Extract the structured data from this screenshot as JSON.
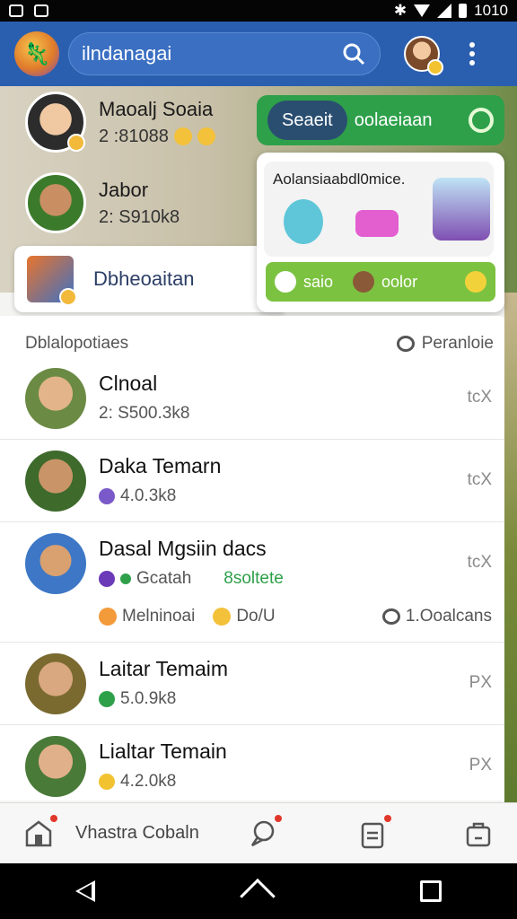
{
  "status_bar": {
    "time": "1010"
  },
  "app_bar": {
    "title": "ilndanagai",
    "logo_icon": "app-logo",
    "search_icon": "search-icon",
    "more_icon": "more-vert-icon"
  },
  "stories": [
    {
      "name": "Maoalj Soaia",
      "sub": "2 :81088"
    },
    {
      "name": "Jabor",
      "sub": "2: S910k8"
    }
  ],
  "highlight": {
    "label": "Dbheoaitan"
  },
  "popup": {
    "tab_selected": "Seaeit",
    "tab_label": "oolaeiaan",
    "card_title": "Aolansiaabdl0mice.",
    "foot_left": "saio",
    "foot_right": "oolor"
  },
  "list": {
    "header_left": "Dblalopotiaes",
    "header_right": "Peranloie",
    "items": [
      {
        "name": "Clnoal",
        "sub": "2: S500.3k8",
        "action": "tcX",
        "avatar_color": "#6b8a44"
      },
      {
        "name": "Daka Temarn",
        "sub": "4.0.3k8",
        "action": "tcX",
        "avatar_color": "#3e6a2c"
      },
      {
        "name": "Dasal Mgsiin dacs",
        "sub": "Gcatah",
        "sub_green": "8soltete",
        "extra_left": "Melninoai",
        "extra_mid": "Do/U",
        "extra_right": "1.Ooalcans",
        "action": "tcX",
        "avatar_color": "#3d77c6"
      },
      {
        "name": "Laitar Temaim",
        "sub": "5.0.9k8",
        "action": "PX",
        "avatar_color": "#7a6a30"
      },
      {
        "name": "Lialtar Temain",
        "sub": "4.2.0k8",
        "action": "PX",
        "avatar_color": "#4a7a38"
      }
    ]
  },
  "bottom_nav": {
    "label": "Vhastra Cobaln"
  }
}
